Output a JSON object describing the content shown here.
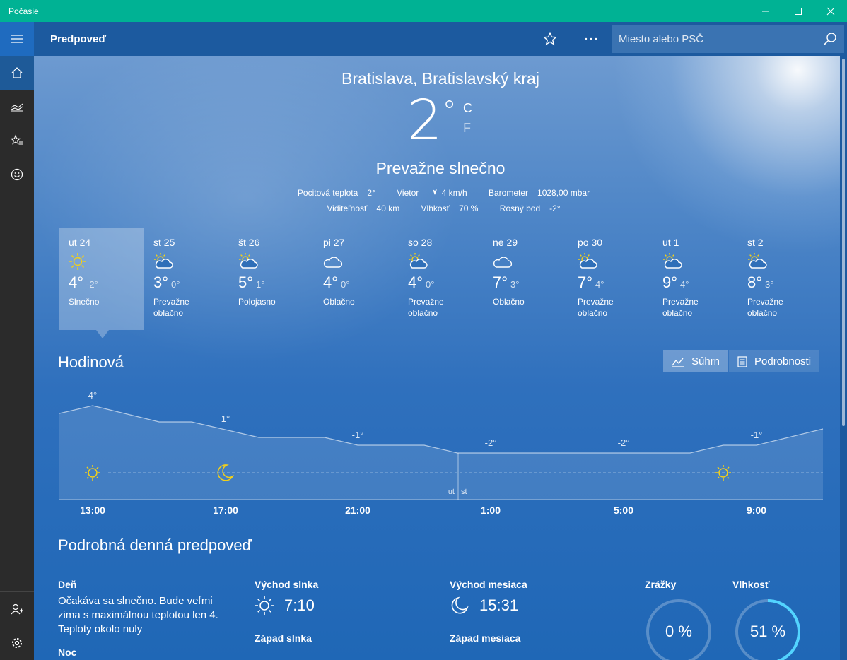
{
  "window": {
    "title": "Počasie"
  },
  "header": {
    "title": "Predpoveď",
    "search_placeholder": "Miesto alebo PSČ"
  },
  "current": {
    "location": "Bratislava, Bratislavský kraj",
    "temperature": "2",
    "degree": "°",
    "unit_c": "C",
    "unit_f": "F",
    "condition": "Prevažne slnečno",
    "feels_like_label": "Pocitová teplota",
    "feels_like": "2°",
    "wind_label": "Vietor",
    "wind": "4 km/h",
    "barometer_label": "Barometer",
    "barometer": "1028,00 mbar",
    "visibility_label": "Viditeľnosť",
    "visibility": "40 km",
    "humidity_label": "Vlhkosť",
    "humidity": "70 %",
    "dewpoint_label": "Rosný bod",
    "dewpoint": "-2°"
  },
  "days": [
    {
      "name": "ut 24",
      "high": "4°",
      "low": "-2°",
      "cond": "Slnečno",
      "icon": "sun-icon"
    },
    {
      "name": "st 25",
      "high": "3°",
      "low": "0°",
      "cond": "Prevažne oblačno",
      "icon": "partly-cloudy-icon"
    },
    {
      "name": "št 26",
      "high": "5°",
      "low": "1°",
      "cond": "Polojasno",
      "icon": "partly-cloudy-icon"
    },
    {
      "name": "pi 27",
      "high": "4°",
      "low": "0°",
      "cond": "Oblačno",
      "icon": "cloud-icon"
    },
    {
      "name": "so 28",
      "high": "4°",
      "low": "0°",
      "cond": "Prevažne oblačno",
      "icon": "partly-cloudy-icon"
    },
    {
      "name": "ne 29",
      "high": "7°",
      "low": "3°",
      "cond": "Oblačno",
      "icon": "cloud-icon"
    },
    {
      "name": "po 30",
      "high": "7°",
      "low": "4°",
      "cond": "Prevažne oblačno",
      "icon": "partly-cloudy-icon"
    },
    {
      "name": "ut 1",
      "high": "9°",
      "low": "4°",
      "cond": "Prevažne oblačno",
      "icon": "partly-cloudy-icon"
    },
    {
      "name": "st 2",
      "high": "8°",
      "low": "3°",
      "cond": "Prevažne oblačno",
      "icon": "partly-cloudy-icon"
    }
  ],
  "hourly": {
    "title": "Hodinová",
    "summary_label": "Súhrn",
    "details_label": "Podrobnosti",
    "times": [
      "13:00",
      "17:00",
      "21:00",
      "1:00",
      "5:00",
      "9:00"
    ],
    "temp_labels": [
      "4°",
      "1°",
      "-1°",
      "-2°",
      "-2°",
      "-1°"
    ],
    "day_split": [
      "ut",
      "st"
    ]
  },
  "detail": {
    "title": "Podrobná denná predpoveď",
    "day_label": "Deň",
    "day_text": "Očakáva sa slnečno. Bude veľmi zima s maximálnou teplotou len 4. Teploty okolo nuly",
    "night_label": "Noc",
    "sunrise_label": "Východ slnka",
    "sunrise": "7:10",
    "sunset_label": "Západ slnka",
    "moonrise_label": "Východ mesiaca",
    "moonrise": "15:31",
    "moonset_label": "Západ mesiaca",
    "precip_label": "Zrážky",
    "precip": "0 %",
    "precip_value": 0,
    "humidity_label": "Vlhkosť",
    "humidity": "51 %",
    "humidity_value": 0.51
  }
}
